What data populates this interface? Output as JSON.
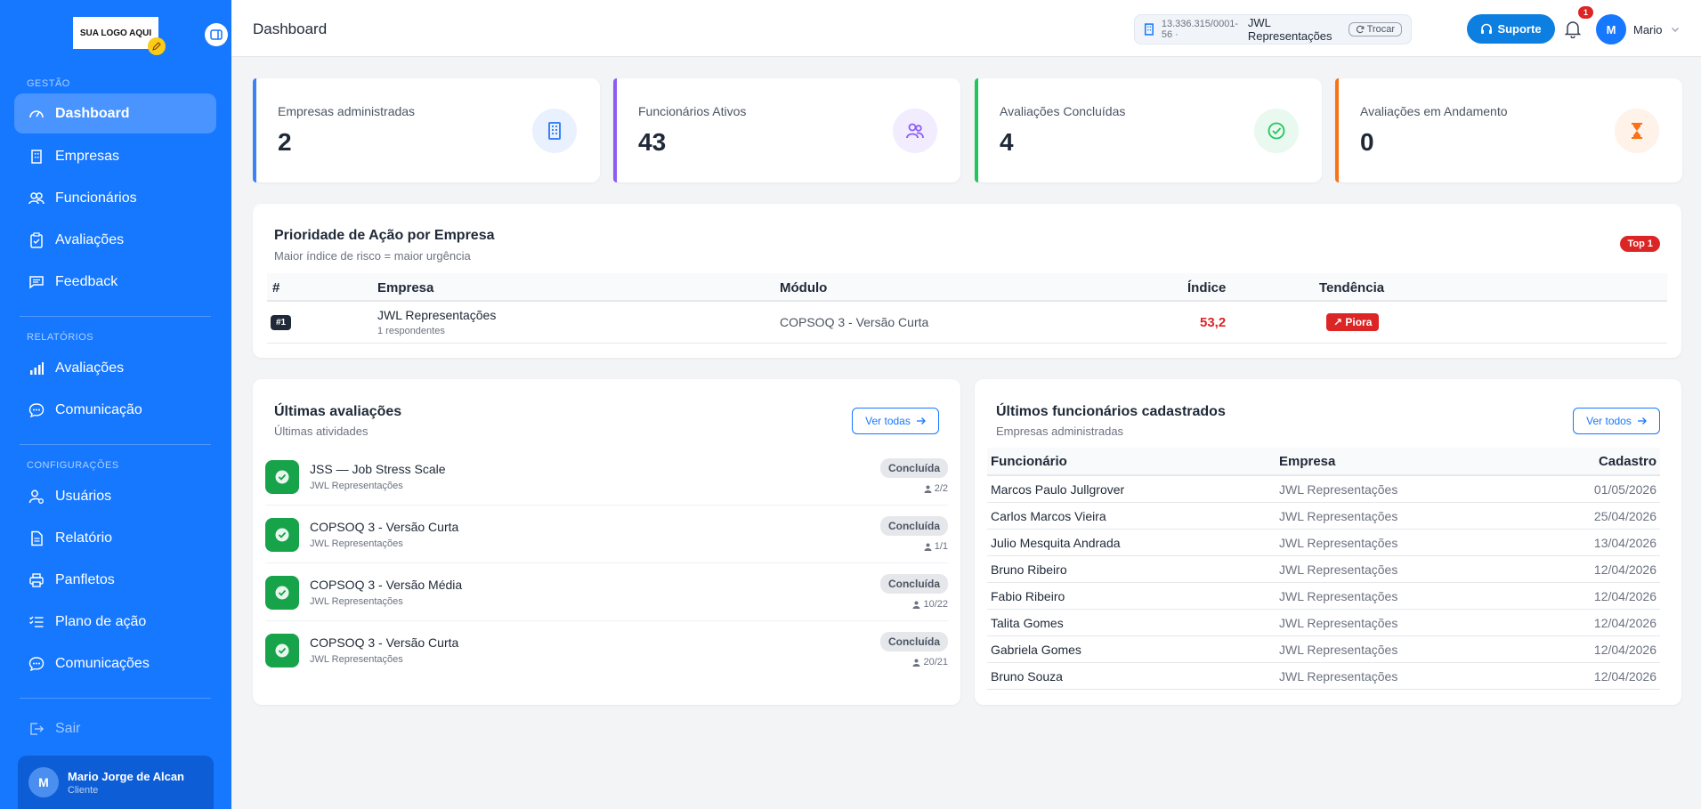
{
  "sidebar": {
    "logo_text": "SUA LOGO AQUI",
    "sections": {
      "gestao": "GESTÃO",
      "relatorios": "RELATÓRIOS",
      "configuracoes": "CONFIGURAÇÕES"
    },
    "items": {
      "dashboard": "Dashboard",
      "empresas": "Empresas",
      "funcionarios": "Funcionários",
      "avaliacoes": "Avaliações",
      "feedback": "Feedback",
      "rel_avaliacoes": "Avaliações",
      "comunicacao": "Comunicação",
      "usuarios": "Usuários",
      "relatorio": "Relatório",
      "panfletos": "Panfletos",
      "plano_acao": "Plano de ação",
      "comunicacoes": "Comunicações",
      "sair": "Sair"
    },
    "user": {
      "initial": "M",
      "name": "Mario Jorge de Alcan",
      "role": "Cliente"
    }
  },
  "header": {
    "title": "Dashboard",
    "cnpj": "13.336.315/0001-56 ·",
    "company": "JWL Representações",
    "switch_label": "Trocar",
    "support_label": "Suporte",
    "notifications": "1",
    "user_initial": "M",
    "user_name": "Mario"
  },
  "stats": [
    {
      "label": "Empresas administradas",
      "value": "2",
      "color": "#3b82f6"
    },
    {
      "label": "Funcionários Ativos",
      "value": "43",
      "color": "#8b5cf6"
    },
    {
      "label": "Avaliações Concluídas",
      "value": "4",
      "color": "#22c55e"
    },
    {
      "label": "Avaliações em Andamento",
      "value": "0",
      "color": "#f97316"
    }
  ],
  "priority": {
    "title": "Prioridade de Ação por Empresa",
    "subtitle": "Maior índice de risco = maior urgência",
    "badge": "Top 1",
    "columns": {
      "rank": "#",
      "empresa": "Empresa",
      "modulo": "Módulo",
      "indice": "Índice",
      "tendencia": "Tendência"
    },
    "row": {
      "rank": "#1",
      "empresa": "JWL Representações",
      "respondentes": "1 respondentes",
      "modulo": "COPSOQ 3 - Versão Curta",
      "indice": "53,2",
      "tendencia": "↗ Piora"
    }
  },
  "evaluations": {
    "title": "Últimas avaliações",
    "subtitle": "Últimas atividades",
    "button": "Ver todas",
    "items": [
      {
        "name": "JSS — Job Stress Scale",
        "company": "JWL Representações",
        "status": "Concluída",
        "count": "2/2"
      },
      {
        "name": "COPSOQ 3 - Versão Curta",
        "company": "JWL Representações",
        "status": "Concluída",
        "count": "1/1"
      },
      {
        "name": "COPSOQ 3 - Versão Média",
        "company": "JWL Representações",
        "status": "Concluída",
        "count": "10/22"
      },
      {
        "name": "COPSOQ 3 - Versão Curta",
        "company": "JWL Representações",
        "status": "Concluída",
        "count": "20/21"
      }
    ]
  },
  "employees": {
    "title": "Últimos funcionários cadastrados",
    "subtitle": "Empresas administradas",
    "button": "Ver todos",
    "columns": {
      "name": "Funcionário",
      "company": "Empresa",
      "date": "Cadastro"
    },
    "rows": [
      {
        "name": "Marcos Paulo Jullgrover",
        "company": "JWL Representações",
        "date": "01/05/2026"
      },
      {
        "name": "Carlos Marcos Vieira",
        "company": "JWL Representações",
        "date": "25/04/2026"
      },
      {
        "name": "Julio Mesquita Andrada",
        "company": "JWL Representações",
        "date": "13/04/2026"
      },
      {
        "name": "Bruno Ribeiro",
        "company": "JWL Representações",
        "date": "12/04/2026"
      },
      {
        "name": "Fabio Ribeiro",
        "company": "JWL Representações",
        "date": "12/04/2026"
      },
      {
        "name": "Talita Gomes",
        "company": "JWL Representações",
        "date": "12/04/2026"
      },
      {
        "name": "Gabriela Gomes",
        "company": "JWL Representações",
        "date": "12/04/2026"
      },
      {
        "name": "Bruno Souza",
        "company": "JWL Representações",
        "date": "12/04/2026"
      }
    ]
  }
}
